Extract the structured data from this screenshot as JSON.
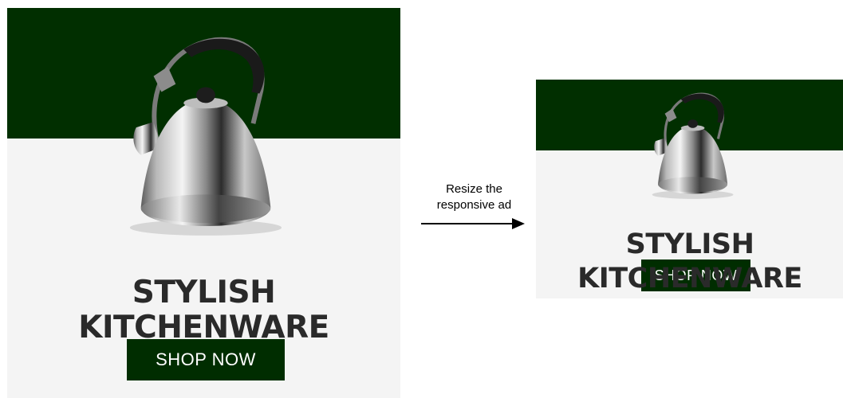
{
  "colors": {
    "band": "#012f00",
    "panel": "#f4f4f4",
    "headline": "#2a2a2a",
    "cta_bg": "#002d00",
    "cta_text": "#ffffff"
  },
  "ad_large": {
    "headline": "STYLISH KITCHENWARE",
    "cta_label": "SHOP NOW"
  },
  "annotation": {
    "line1": "Resize the",
    "line2": "responsive ad"
  },
  "ad_small": {
    "headline_line1": "STYLISH",
    "headline_line2": "KITCHENWARE",
    "cta_label": "SHOP NOW"
  }
}
